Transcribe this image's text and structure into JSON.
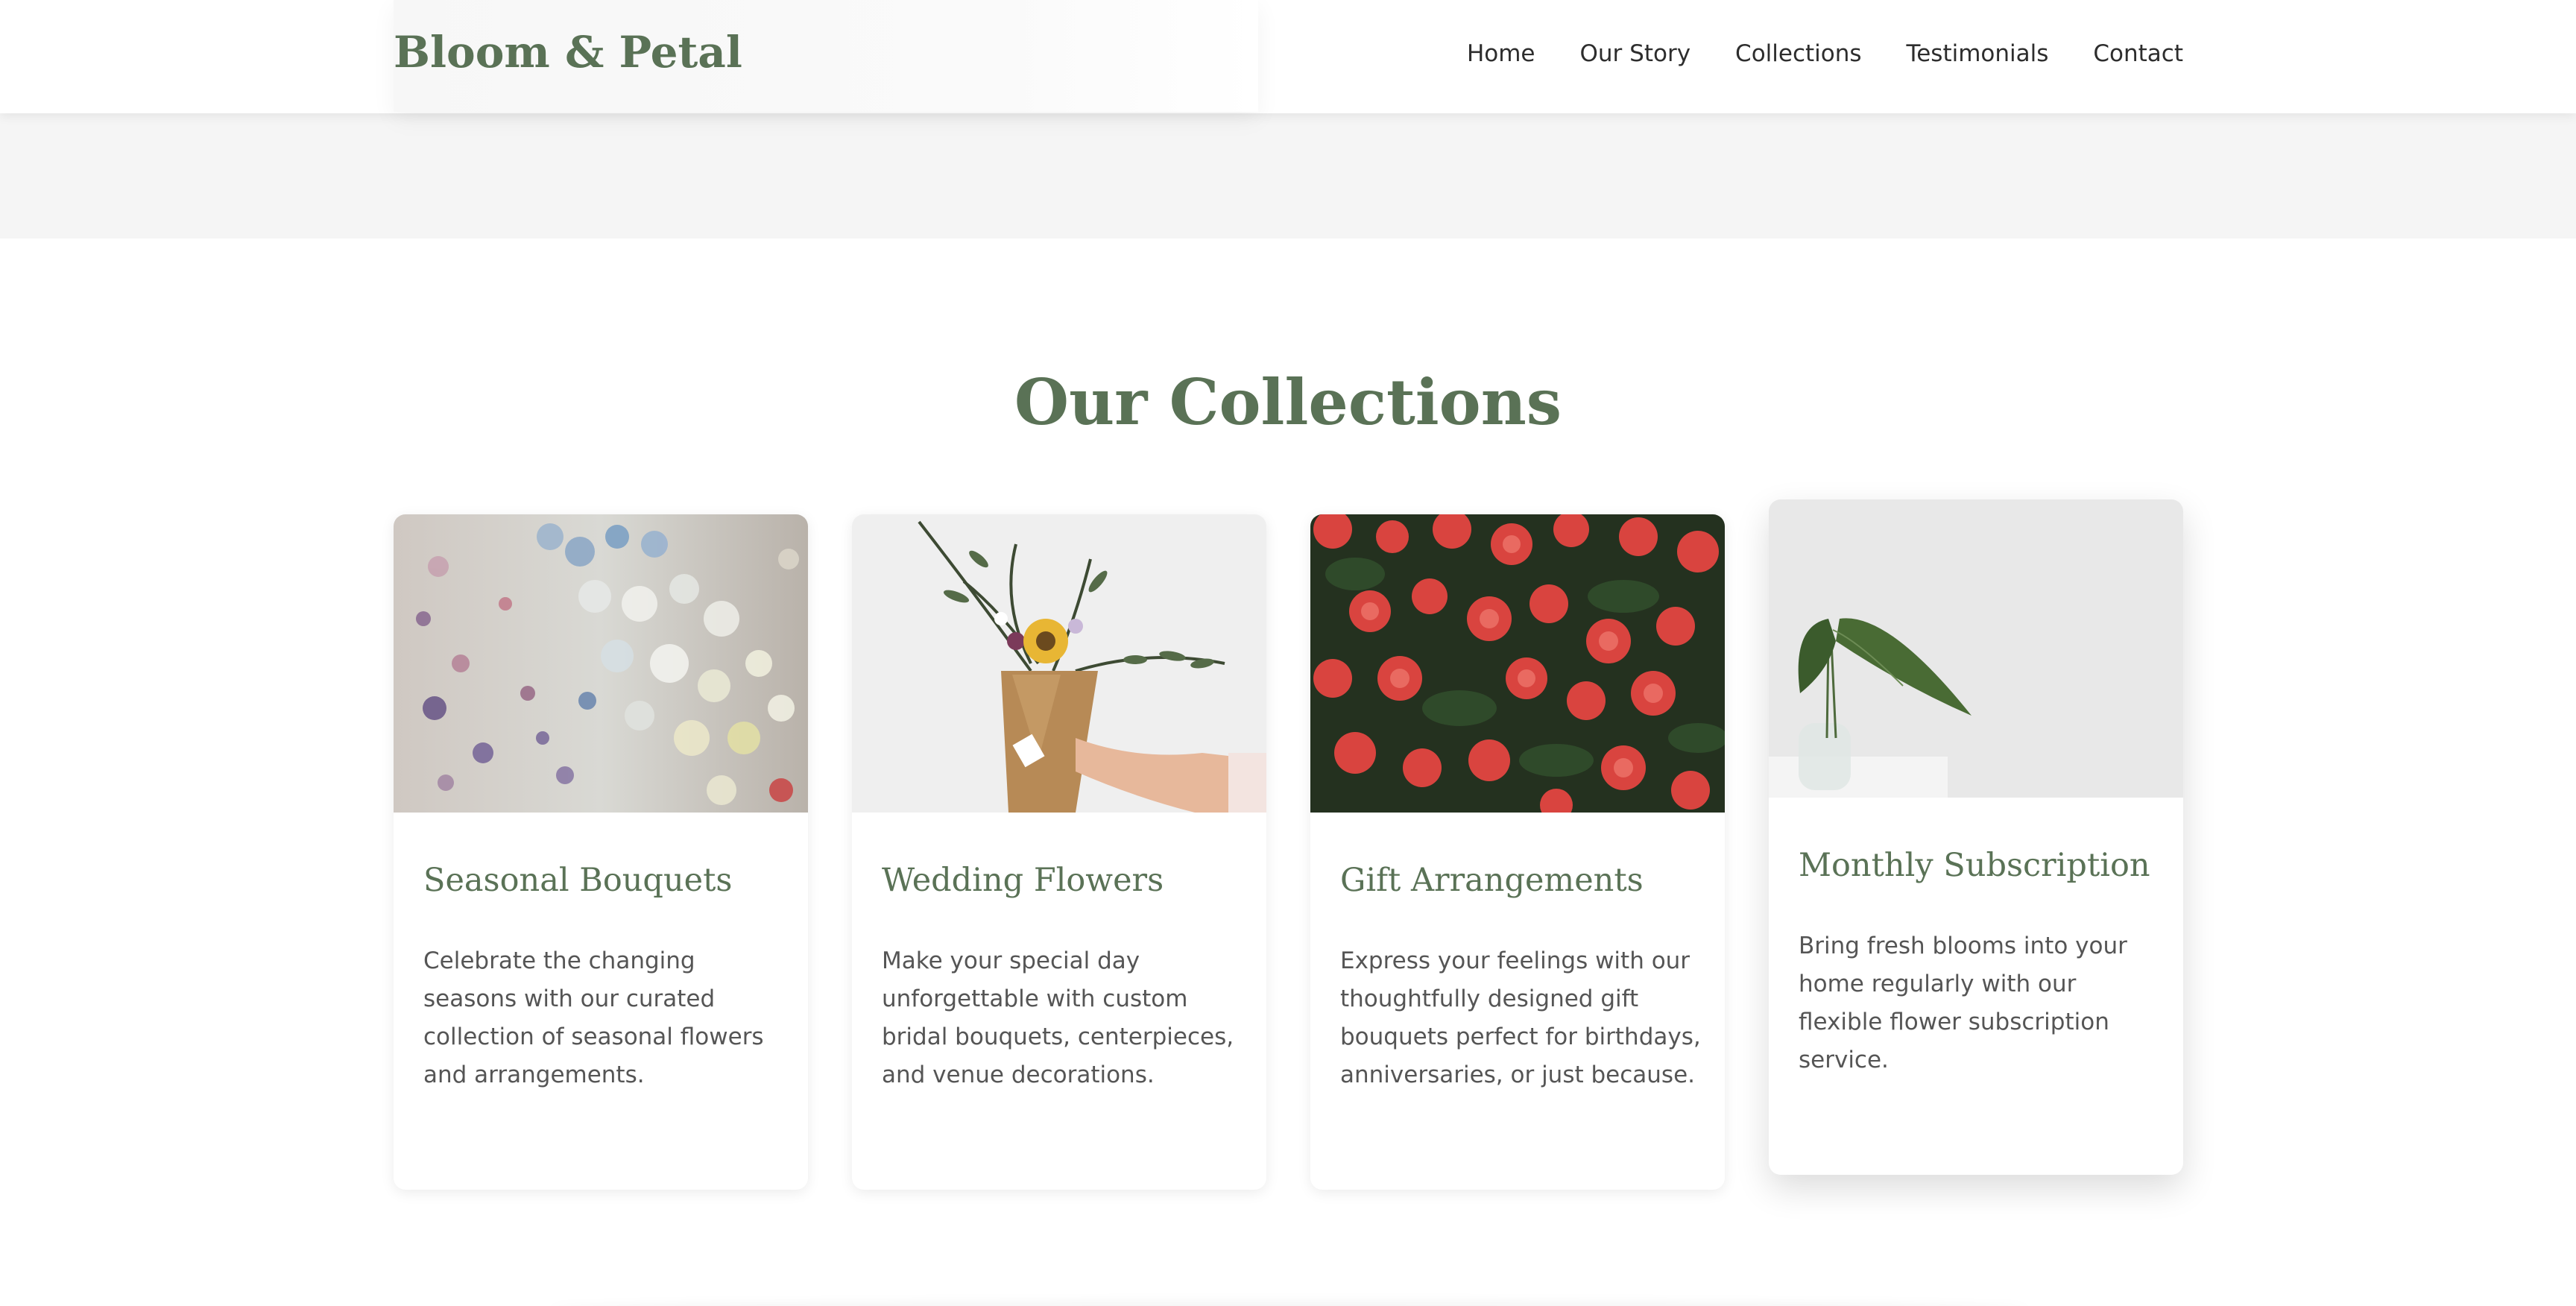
{
  "header": {
    "logo": "Bloom & Petal",
    "nav": [
      "Home",
      "Our Story",
      "Collections",
      "Testimonials",
      "Contact"
    ]
  },
  "collections": {
    "title": "Our Collections",
    "cards": [
      {
        "title": "Seasonal Bouquets",
        "description": "Celebrate the changing seasons with our curated collection of seasonal flowers and arrangements.",
        "image": "baby's breath flowers in pastel colors"
      },
      {
        "title": "Wedding Flowers",
        "description": "Make your special day unforgettable with custom bridal bouquets, centerpieces, and venue decorations.",
        "image": "hand holding a sunflower bouquet wrapped in kraft paper"
      },
      {
        "title": "Gift Arrangements",
        "description": "Express your feelings with our thoughtfully designed gift bouquets perfect for birthdays, anniversaries, or just because.",
        "image": "field of red begonia flowers"
      },
      {
        "title": "Monthly Subscription",
        "description": "Bring fresh blooms into your home regularly with our flexible flower subscription service.",
        "image": "green leaves in a glass vase"
      }
    ]
  },
  "colors": {
    "brand_green": "#5a7256",
    "text": "#555555",
    "strip": "#f5f5f5"
  }
}
